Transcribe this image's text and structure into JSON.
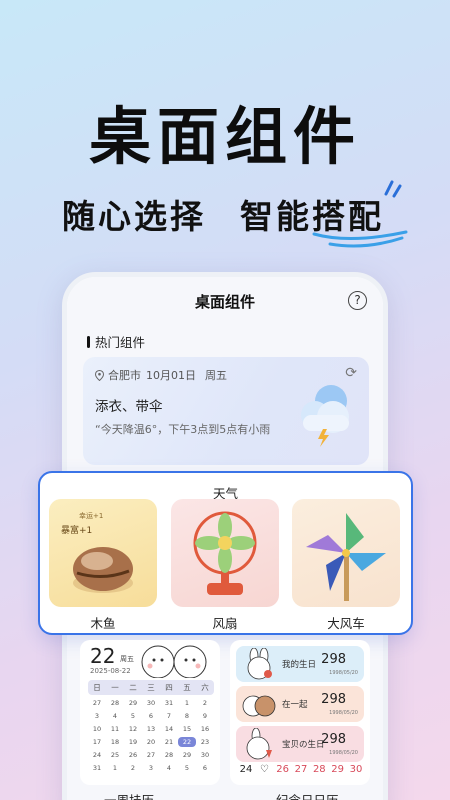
{
  "hero": {
    "headline": "桌面组件",
    "sub_left": "随心选择",
    "sub_right": "智能搭配"
  },
  "phone": {
    "title": "桌面组件",
    "help_icon": "?",
    "section_label": "热门组件"
  },
  "weather": {
    "location": "合肥市",
    "date": "10月01日",
    "weekday": "周五",
    "advice": "添衣、带伞",
    "forecast": "“今天降温6°，下午3点到5点有小雨"
  },
  "popup": {
    "title": "天气",
    "tiles": [
      {
        "label": "木鱼",
        "small_1": "幸运+1",
        "small_2": "暴富+1"
      },
      {
        "label": "风扇"
      },
      {
        "label": "大风车"
      }
    ]
  },
  "calendar": {
    "day": "22",
    "weekday": "周五",
    "date": "2025-08-22",
    "header": [
      "日",
      "一",
      "二",
      "三",
      "四",
      "五",
      "六"
    ],
    "cells": [
      "27",
      "28",
      "29",
      "30",
      "31",
      "1",
      "2",
      "3",
      "4",
      "5",
      "6",
      "7",
      "8",
      "9",
      "10",
      "11",
      "12",
      "13",
      "14",
      "15",
      "16",
      "17",
      "18",
      "19",
      "20",
      "21",
      "22",
      "23",
      "24",
      "25",
      "26",
      "27",
      "28",
      "29",
      "30",
      "31",
      "1",
      "2",
      "3",
      "4",
      "5",
      "6"
    ],
    "selected": "22",
    "label": "一周挂历"
  },
  "anniversary": {
    "rows": [
      {
        "label": "我的生日",
        "value": "298",
        "sub": "1998/05/20"
      },
      {
        "label": "在一起",
        "value": "298",
        "sub": "1998/05/20"
      },
      {
        "label": "宝贝の生日",
        "value": "298",
        "sub": "1998/05/20"
      }
    ],
    "strip": [
      "24",
      "♡",
      "26",
      "27",
      "28",
      "29",
      "30"
    ],
    "label": "纪念日日历"
  },
  "colors": {
    "accent": "#3a74e8",
    "calendar_selected": "#7a86d8"
  }
}
